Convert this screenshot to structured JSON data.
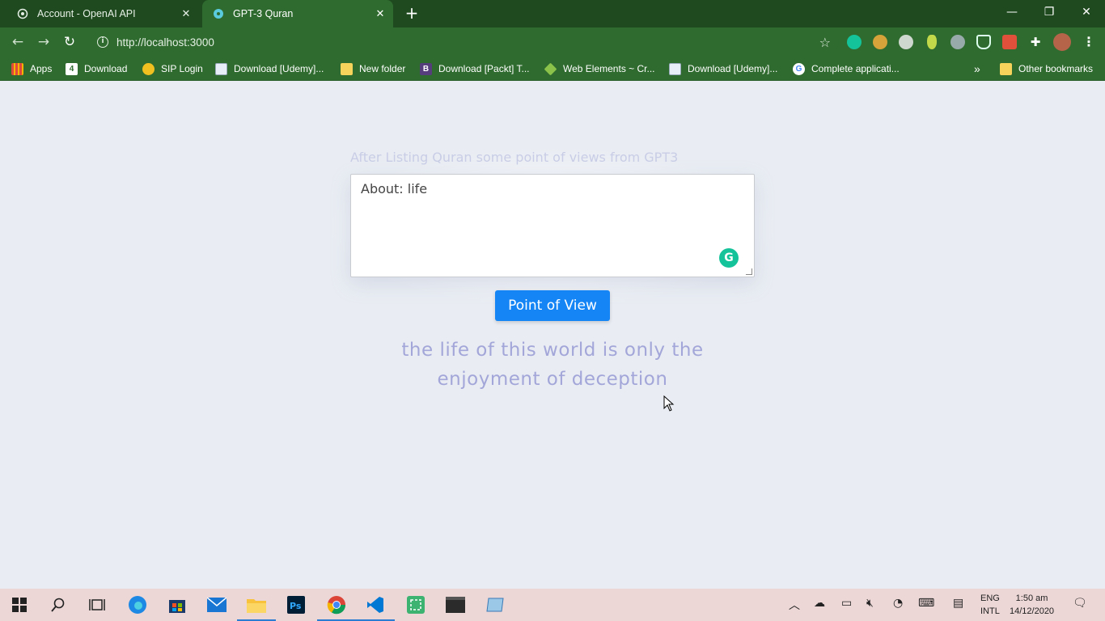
{
  "browser": {
    "tabs": [
      {
        "title": "Account - OpenAI API",
        "active": false,
        "favicon": "openai-icon"
      },
      {
        "title": "GPT-3 Quran",
        "active": true,
        "favicon": "react-icon"
      }
    ],
    "url": "http://localhost:3000",
    "bookmarks": [
      {
        "label": "Apps",
        "icon": "apps-grid-icon"
      },
      {
        "label": "Download",
        "icon": "download-site-icon"
      },
      {
        "label": "SIP Login",
        "icon": "sip-icon"
      },
      {
        "label": "Download [Udemy]...",
        "icon": "page-icon"
      },
      {
        "label": "New folder",
        "icon": "folder-icon"
      },
      {
        "label": "Download [Packt] T...",
        "icon": "bootstrap-icon"
      },
      {
        "label": "Web Elements ~ Cr...",
        "icon": "tag-icon"
      },
      {
        "label": "Download [Udemy]...",
        "icon": "page-icon"
      },
      {
        "label": "Complete applicati...",
        "icon": "google-icon"
      }
    ],
    "overflow_label": "»",
    "other_bookmarks": "Other bookmarks"
  },
  "page": {
    "heading": "After Listing Quran some point of views from GPT3",
    "textarea_value": "About: life",
    "button_label": "Point of View",
    "result_line1": "the life of this world is only the",
    "result_line2": "enjoyment of deception"
  },
  "taskbar": {
    "lang_line1": "ENG",
    "lang_line2": "INTL",
    "time": "1:50 am",
    "date": "14/12/2020"
  },
  "colors": {
    "tabstrip": "#1f4a1f",
    "toolbar": "#2f6b2f",
    "page_bg": "#e9edf3",
    "button": "#1585f5",
    "result_text": "#a3a6d8",
    "taskbar": "#ecd6d6"
  }
}
